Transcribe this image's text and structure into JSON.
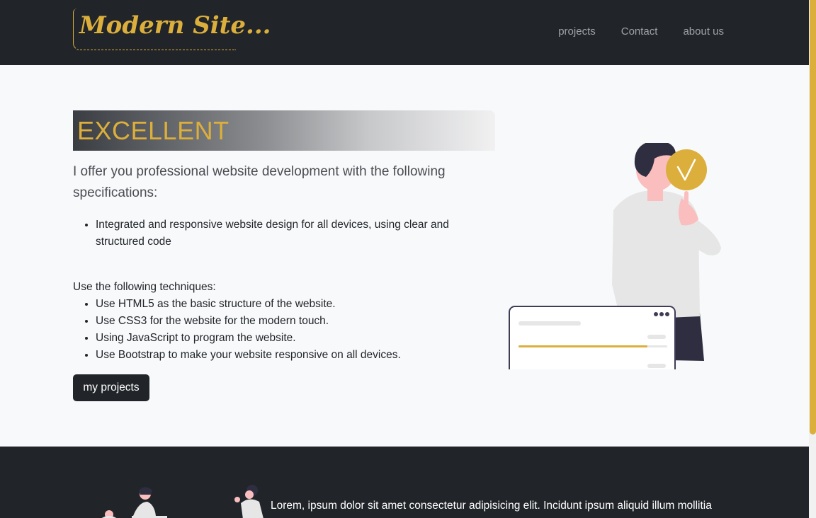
{
  "header": {
    "brand": "Modern Site...",
    "nav": [
      {
        "label": "projects"
      },
      {
        "label": "Contact"
      },
      {
        "label": "about us"
      }
    ]
  },
  "hero": {
    "heading": "EXCELLENT",
    "lead": "I offer you professional website development with the following specifications:",
    "specs": [
      "Integrated and responsive website design for all devices, using clear and structured code"
    ],
    "techniques_intro": "Use the following techniques:",
    "techniques": [
      "Use HTML5 as the basic structure of the website.",
      "Use CSS3 for the website for the modern touch.",
      "Using JavaScript to program the website.",
      "Use Bootstrap to make your website responsive on all devices."
    ],
    "button_label": "my projects"
  },
  "next_section": {
    "text": "Lorem, ipsum dolor sit amet consectetur adipisicing elit. Incidunt ipsum aliquid illum mollitia"
  },
  "colors": {
    "accent": "#dcaf3c",
    "dark": "#212529",
    "light": "#f8f9fa"
  }
}
